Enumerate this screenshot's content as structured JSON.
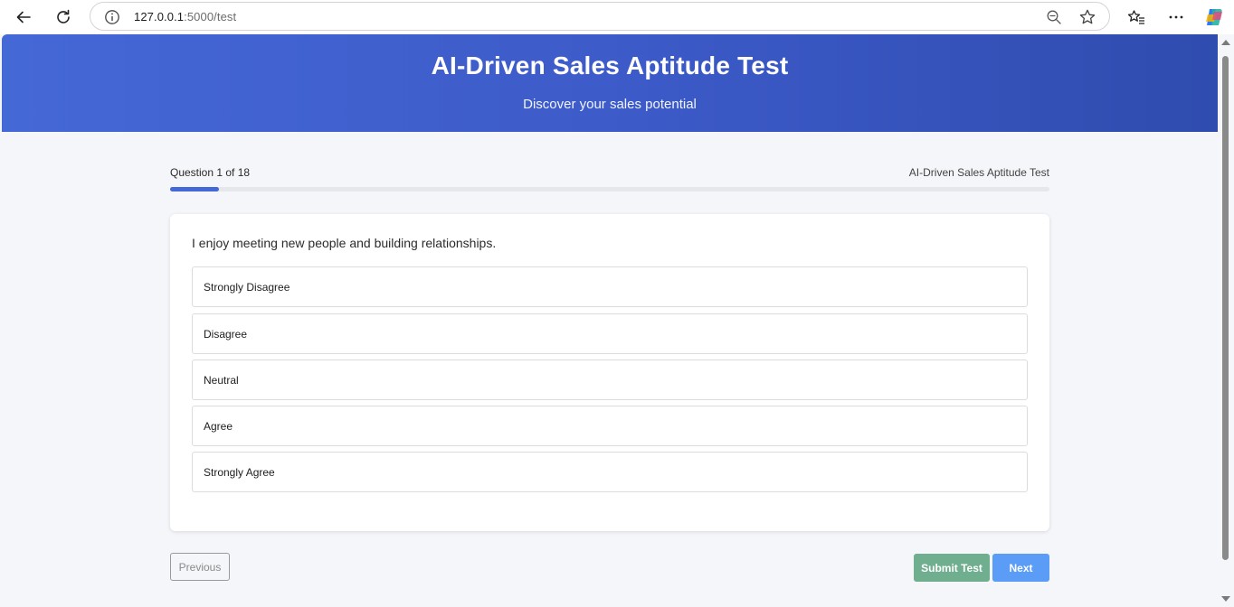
{
  "browser": {
    "url_host": "127.0.0.1",
    "url_path": ":5000/test",
    "icons": [
      "back-icon",
      "reload-icon",
      "info-icon",
      "zoom-out-icon",
      "favorite-star-icon",
      "favorites-icon",
      "more-icon",
      "copilot-icon"
    ]
  },
  "header": {
    "title": "AI-Driven Sales Aptitude Test",
    "subtitle": "Discover your sales potential"
  },
  "progress": {
    "label": "Question 1 of 18",
    "test_name": "AI-Driven Sales Aptitude Test",
    "fraction": 0.0556
  },
  "question": {
    "text": "I enjoy meeting new people and building relationships.",
    "options": [
      "Strongly Disagree",
      "Disagree",
      "Neutral",
      "Agree",
      "Strongly Agree"
    ]
  },
  "buttons": {
    "previous": "Previous",
    "submit": "Submit Test",
    "next": "Next"
  },
  "colors": {
    "header_start": "#4468d6",
    "header_end": "#2f4caf",
    "progress": "#4468d6",
    "submit": "#6fae8e",
    "next": "#5b9cf6"
  }
}
